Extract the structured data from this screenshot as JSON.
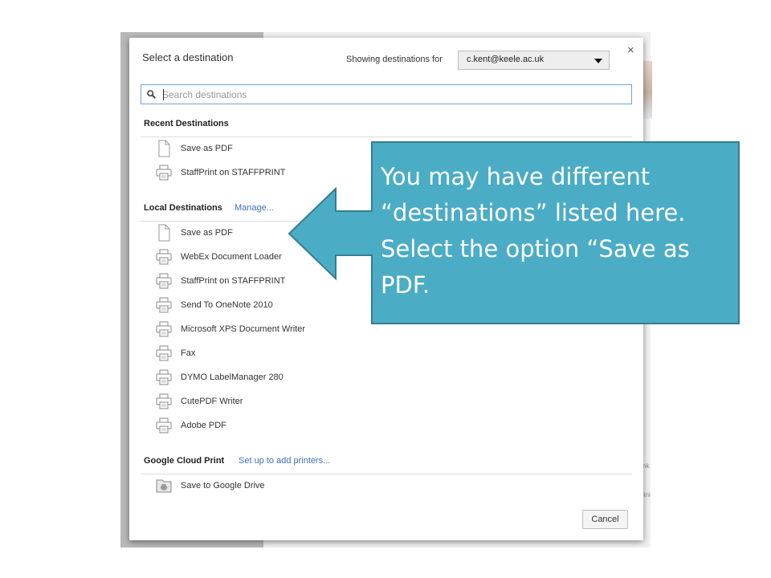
{
  "dialog": {
    "title": "Select a destination",
    "showing_label": "Showing destinations for",
    "account": "c.kent@keele.ac.uk",
    "close_label": "×",
    "search_placeholder": "Search destinations",
    "cancel_label": "Cancel"
  },
  "sections": {
    "recent": {
      "header": "Recent Destinations",
      "items": [
        {
          "label": "Save as PDF",
          "icon": "document-icon"
        },
        {
          "label": "StaffPrint on STAFFPRINT",
          "icon": "printer-icon"
        }
      ]
    },
    "local": {
      "header": "Local Destinations",
      "link": "Manage...",
      "items": [
        {
          "label": "Save as PDF",
          "icon": "document-icon"
        },
        {
          "label": "WebEx Document Loader",
          "icon": "printer-icon"
        },
        {
          "label": "StaffPrint on STAFFPRINT",
          "icon": "printer-icon"
        },
        {
          "label": "Send To OneNote 2010",
          "icon": "printer-icon"
        },
        {
          "label": "Microsoft XPS Document Writer",
          "icon": "printer-icon"
        },
        {
          "label": "Fax",
          "icon": "printer-icon"
        },
        {
          "label": "DYMO LabelManager 280",
          "icon": "printer-icon"
        },
        {
          "label": "CutePDF Writer",
          "icon": "printer-icon"
        },
        {
          "label": "Adobe PDF",
          "icon": "printer-icon"
        }
      ]
    },
    "cloud": {
      "header": "Google Cloud Print",
      "link": "Set up to add printers...",
      "items": [
        {
          "label": "Save to Google Drive",
          "icon": "google-drive-icon"
        }
      ]
    }
  },
  "callout": {
    "lines": [
      "You may have different",
      "“destinations”  listed here.",
      "Select the option “Save as",
      "PDF."
    ],
    "fill_color": "#4bacc6",
    "border_color": "#357d91"
  },
  "background": {
    "snippet_1": "nk",
    "snippet_2": "lini"
  },
  "colors": {
    "link": "#3d6fbf",
    "search_border": "#6fa3d8"
  }
}
